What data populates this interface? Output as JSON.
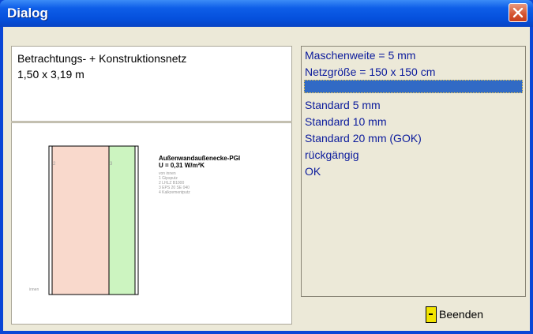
{
  "window": {
    "title": "Dialog"
  },
  "info": {
    "line1": "Betrachtungs- + Konstruktionsnetz",
    "line2": "1,50 x 3,19 m"
  },
  "drawing": {
    "heading": "Außenwandaußenecke-PGI",
    "u_value": "U = 0,31 W/m²K",
    "caption": "von innen",
    "layers": [
      "1 Gipsputz",
      "2 LHLZ B1000",
      "3 EPS 20 SE 040",
      "4 Kalkzementputz"
    ],
    "label_2": "2",
    "label_3": "3",
    "inside_label": "innen",
    "colors": {
      "layer2": "#f9d9cc",
      "layer3": "#ccf4c0"
    }
  },
  "options": {
    "items": [
      "Maschenweite = 5 mm",
      "Netzgröße = 150 x 150 cm",
      "",
      "Standard 5 mm",
      "Standard 10 mm",
      "Standard 20 mm (GOK)",
      "rückgängig",
      "OK"
    ],
    "selected_index": 2
  },
  "buttons": {
    "exit_label": "Beenden"
  },
  "icons": {
    "close": "close-icon",
    "exit": "door-icon"
  }
}
